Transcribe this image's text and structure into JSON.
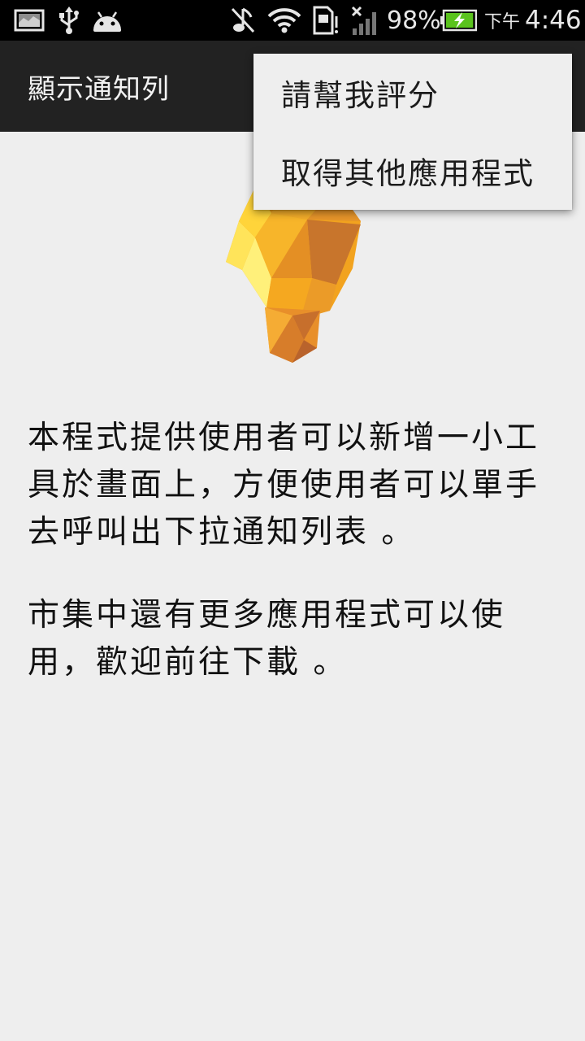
{
  "status_bar": {
    "battery_percent": "98%",
    "battery_level": 0.98,
    "time_period": "下午",
    "time": "4:46",
    "icons": [
      "screenshot-icon",
      "usb-icon",
      "android-debug-icon",
      "muted-icon",
      "wifi-icon",
      "sim-card-icon",
      "signal-icon",
      "battery-charging-icon"
    ]
  },
  "action_bar": {
    "title": "顯示通知列"
  },
  "overflow_menu": {
    "items": [
      {
        "label": "請幫我評分"
      },
      {
        "label": "取得其他應用程式"
      }
    ]
  },
  "main": {
    "logo_icon": "lightbulb-icon",
    "description_1": "本程式提供使用者可以新增一小工具於畫面上，方便使用者可以單手去呼叫出下拉通知列表 。",
    "description_2": "市集中還有更多應用程式可以使用，歡迎前往下載 。"
  },
  "colors": {
    "status_bar_bg": "#000000",
    "action_bar_bg": "#222222",
    "page_bg": "#eeeeee",
    "battery_green": "#5ac31d",
    "bulb_orange": "#f0a020"
  }
}
